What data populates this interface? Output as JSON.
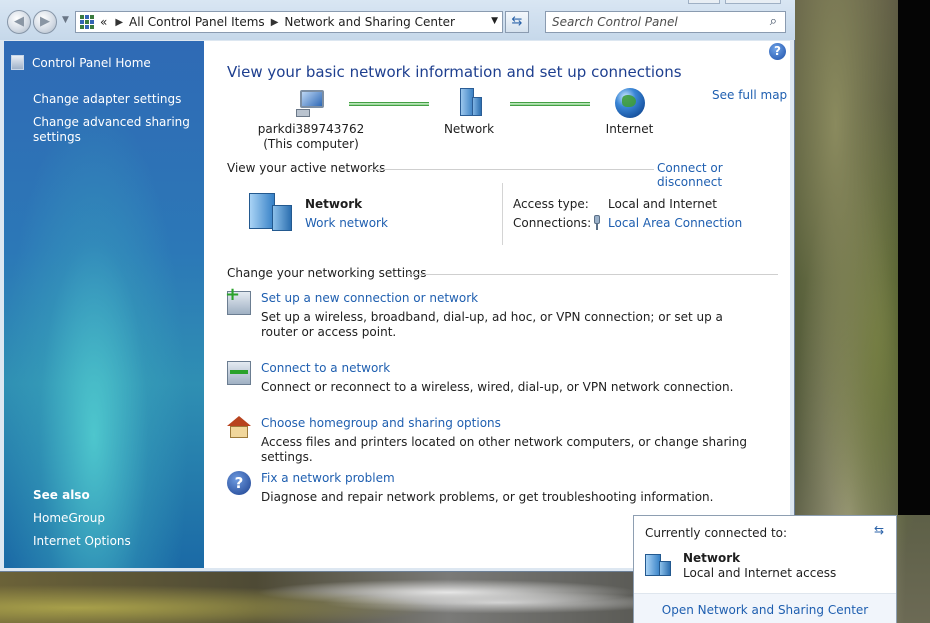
{
  "address_bar": {
    "chevrons": "«",
    "crumbs": [
      "All Control Panel Items",
      "Network and Sharing Center"
    ]
  },
  "search": {
    "placeholder": "Search Control Panel"
  },
  "sidebar": {
    "home": "Control Panel Home",
    "links": [
      "Change adapter settings",
      "Change advanced sharing settings"
    ],
    "see_also_title": "See also",
    "see_also": [
      "HomeGroup",
      "Internet Options"
    ]
  },
  "main": {
    "title": "View your basic network information and set up connections",
    "see_full_map": "See full map",
    "map": {
      "computer_name": "parkdi389743762",
      "computer_note": "(This computer)",
      "network": "Network",
      "internet": "Internet"
    },
    "active_networks": {
      "heading": "View your active networks",
      "connect_link": "Connect or disconnect",
      "network_name": "Network",
      "network_type": "Work network",
      "access_label": "Access type:",
      "access_value": "Local and Internet",
      "connections_label": "Connections:",
      "connections_value": "Local Area Connection"
    },
    "change_settings": {
      "heading": "Change your networking settings",
      "tasks": [
        {
          "title": "Set up a new connection or network",
          "desc": "Set up a wireless, broadband, dial-up, ad hoc, or VPN connection; or set up a router or access point.",
          "icon": "new-connection-icon"
        },
        {
          "title": "Connect to a network",
          "desc": "Connect or reconnect to a wireless, wired, dial-up, or VPN network connection.",
          "icon": "connect-network-icon"
        },
        {
          "title": "Choose homegroup and sharing options",
          "desc": "Access files and printers located on other network computers, or change sharing settings.",
          "icon": "homegroup-icon"
        },
        {
          "title": "Fix a network problem",
          "desc": "Diagnose and repair network problems, or get troubleshooting information.",
          "icon": "troubleshoot-icon"
        }
      ]
    }
  },
  "flyout": {
    "heading": "Currently connected to:",
    "network_name": "Network",
    "network_status": "Local and Internet access",
    "footer_link": "Open Network and Sharing Center"
  }
}
